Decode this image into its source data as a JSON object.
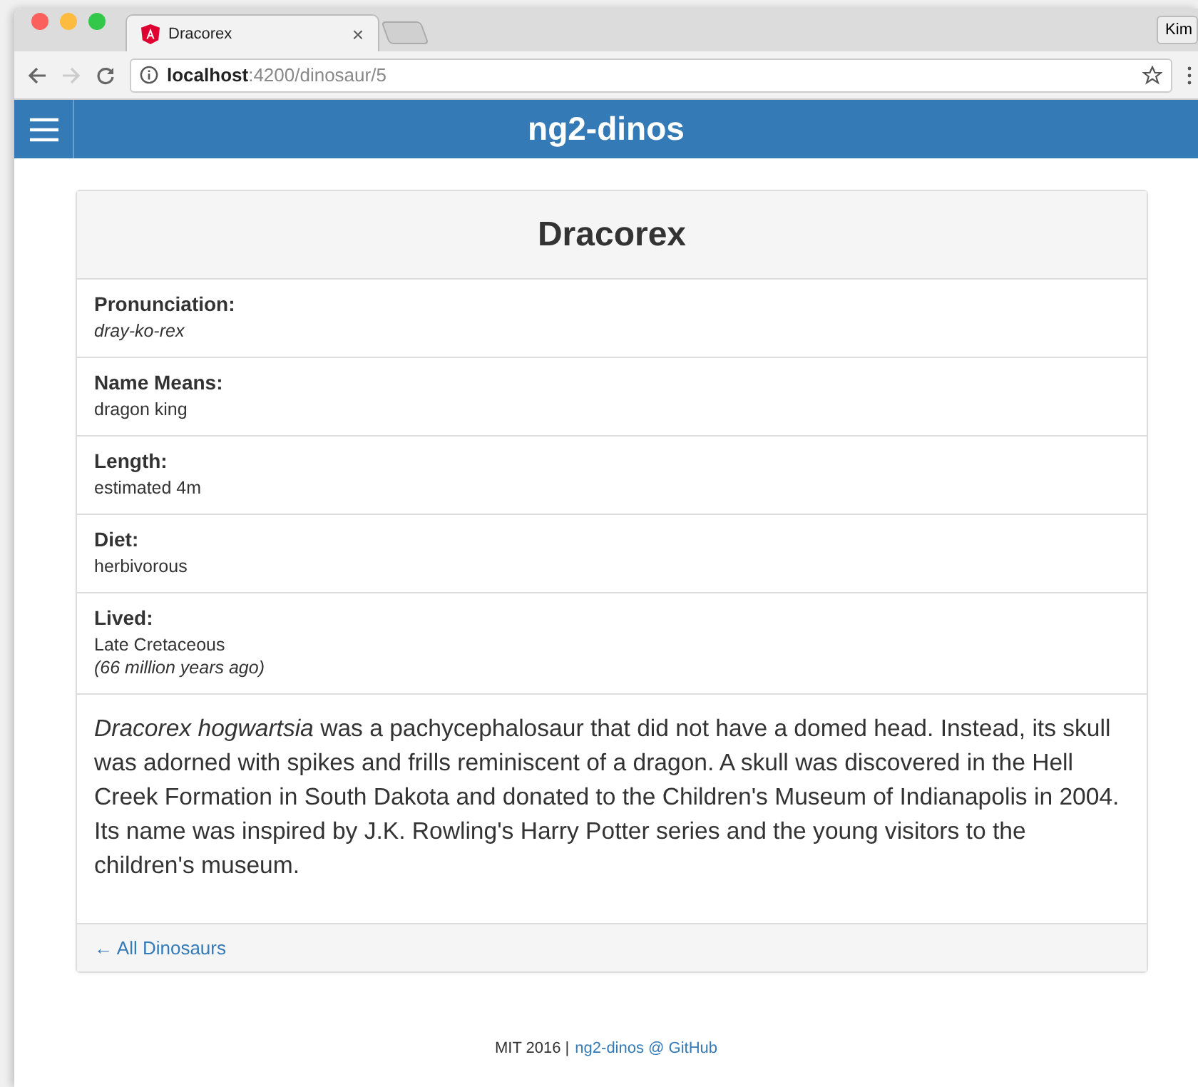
{
  "browser": {
    "tab_title": "Dracorex",
    "tab_close": "×",
    "profile": "Kim",
    "url_host": "localhost",
    "url_path": ":4200/dinosaur/5"
  },
  "navbar": {
    "title": "ng2-dinos"
  },
  "card": {
    "title": "Dracorex",
    "facts": [
      {
        "label": "Pronunciation:",
        "lines": [
          {
            "text": "dray-ko-rex",
            "italic": true
          }
        ]
      },
      {
        "label": "Name Means:",
        "lines": [
          {
            "text": "dragon king",
            "italic": false
          }
        ]
      },
      {
        "label": "Length:",
        "lines": [
          {
            "text": "estimated 4m",
            "italic": false
          }
        ]
      },
      {
        "label": "Diet:",
        "lines": [
          {
            "text": "herbivorous",
            "italic": false
          }
        ]
      },
      {
        "label": "Lived:",
        "lines": [
          {
            "text": "Late Cretaceous",
            "italic": false
          },
          {
            "text": "(66 million years ago)",
            "italic": true
          }
        ]
      }
    ],
    "description": "*Dracorex hogwartsia* was a pachycephalosaur that did not have a domed head. Instead, its skull was adorned with spikes and frills reminiscent of a dragon. A skull was discovered in the Hell Creek Formation in South Dakota and donated to the Children's Museum of Indianapolis in 2004. Its name was inspired by J.K. Rowling's Harry Potter series and the young visitors to the children's museum.",
    "back_link": "← All Dinosaurs"
  },
  "footer": {
    "text": "MIT 2016 |",
    "link": "ng2-dinos @ GitHub"
  }
}
